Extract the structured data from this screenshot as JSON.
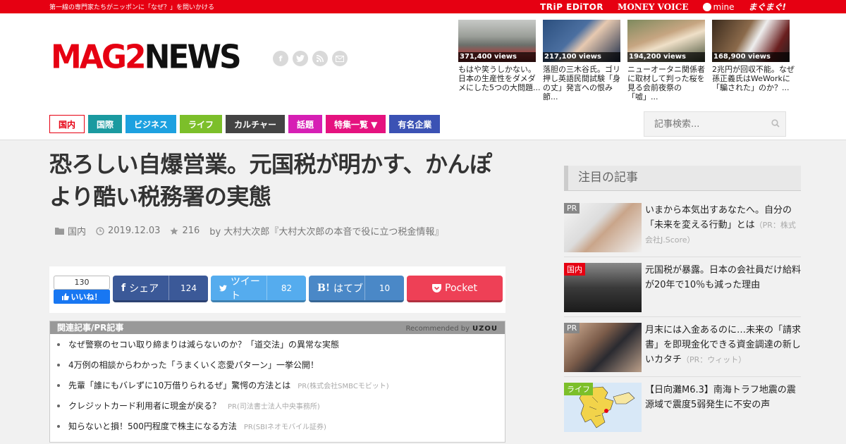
{
  "topbar": {
    "tagline": "第一線の専門家たちがニッポンに「なぜ？」を問いかける",
    "partners": [
      "TRiP EDiTOR",
      "MONEY VOICE",
      "mine",
      "まぐまぐ!"
    ]
  },
  "logo": {
    "red": "MAG2",
    "black": "NEWS"
  },
  "social_icons": [
    "facebook-icon",
    "twitter-icon",
    "rss-icon",
    "mail-icon"
  ],
  "top_news": [
    {
      "views": "371,400 views",
      "title": "もはや笑うしかない。日本の生産性をダメダメにした5つの大問題..."
    },
    {
      "views": "217,100 views",
      "title": "落胆の三木谷氏。ゴリ押し英語民間試験「身の丈」発言への恨み節..."
    },
    {
      "views": "194,200 views",
      "title": "ニューオータニ関係者に取材して判った桜を見る会前夜祭の「嘘」..."
    },
    {
      "views": "168,900 views",
      "title": "2兆円が回収不能。なぜ孫正義氏はWeWorkに「騙された」のか？..."
    }
  ],
  "nav": [
    {
      "label": "国内",
      "color": "#e60012"
    },
    {
      "label": "国際",
      "color": "#1a9aa0"
    },
    {
      "label": "ビジネス",
      "color": "#1da1e0"
    },
    {
      "label": "ライフ",
      "color": "#7cbf2a"
    },
    {
      "label": "カルチャー",
      "color": "#444444"
    },
    {
      "label": "話題",
      "color": "#d61fb4"
    },
    {
      "label": "特集一覧 ▼",
      "color": "#e5127f"
    },
    {
      "label": "有名企業",
      "color": "#3b52b4"
    }
  ],
  "search": {
    "placeholder": "記事検索..."
  },
  "article": {
    "title": "恐ろしい自爆営業。元国税が明かす、かんぽより酷い税務署の実態",
    "category": "国内",
    "date": "2019.12.03",
    "stars": "216",
    "author": "by 大村大次郎『大村大次郎の本音で役に立つ税金情報』"
  },
  "share": {
    "like_count": "130",
    "like_label": "いいね！",
    "facebook": {
      "label": "シェア",
      "count": "124"
    },
    "twitter": {
      "label": "ツイート",
      "count": "82"
    },
    "hatena": {
      "label": "はてブ",
      "count": "10"
    },
    "pocket": {
      "label": "Pocket"
    }
  },
  "related": {
    "heading": "関連記事/PR記事",
    "recommended": "Recommended by",
    "recommended_brand": "UZOU",
    "items": [
      {
        "title": "なぜ警察のセコい取り締まりは減らないのか？「道交法」の異常な実態",
        "pr": ""
      },
      {
        "title": "4万例の相談からわかった「うまくいく恋愛パターン」一挙公開！",
        "pr": ""
      },
      {
        "title": "先輩「誰にもバレずに10万借りられるぜ」驚愕の方法とは",
        "pr": "PR(株式会社SMBCモビット)"
      },
      {
        "title": "クレジットカード利用者に現金が戻る？",
        "pr": "PR(司法書士法人中央事務所)"
      },
      {
        "title": "知らないと損！500円程度で株主になる方法",
        "pr": "PR(SBIネオモバイル証券)"
      }
    ]
  },
  "sidebar": {
    "heading": "注目の記事",
    "items": [
      {
        "tag": "PR",
        "tag_color": "#888888",
        "title": "いまから本気出すあなたへ。自分の「未来を変える行動」とは",
        "note": "（PR：株式会社J.Score）"
      },
      {
        "tag": "国内",
        "tag_color": "#e60012",
        "title": "元国税が暴露。日本の会社員だけ給料が20年で10％も減った理由",
        "note": ""
      },
      {
        "tag": "PR",
        "tag_color": "#888888",
        "title": "月末には入金あるのに…未来の「請求書」を即現金化できる資金調達の新しいカタチ",
        "note": "（PR：ウィット）"
      },
      {
        "tag": "ライフ",
        "tag_color": "#7cbf2a",
        "title": "【日向灘M6.3】南海トラフ地震の震源域で震度5弱発生に不安の声",
        "note": ""
      }
    ]
  }
}
